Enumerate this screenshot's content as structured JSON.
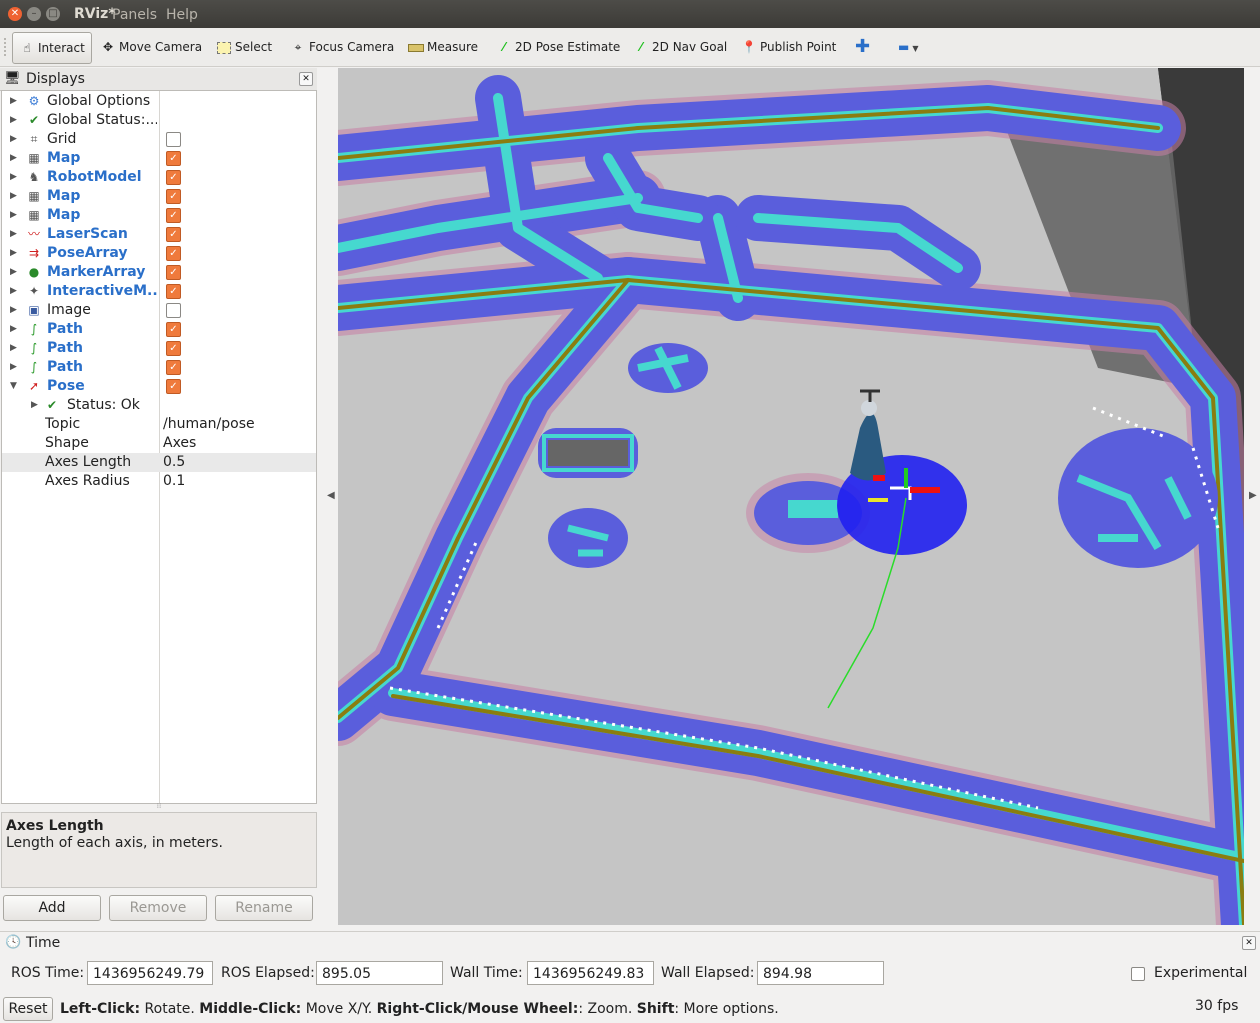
{
  "window": {
    "app_title": "RViz*",
    "menus": [
      "Panels",
      "Help"
    ]
  },
  "toolbar": {
    "tools": [
      {
        "label": "Interact",
        "icon": "hand-pointer-icon"
      },
      {
        "label": "Move Camera",
        "icon": "move-camera-icon"
      },
      {
        "label": "Select",
        "icon": "select-box-icon"
      },
      {
        "label": "Focus Camera",
        "icon": "focus-crosshair-icon"
      },
      {
        "label": "Measure",
        "icon": "ruler-icon"
      },
      {
        "label": "2D Pose Estimate",
        "icon": "pose-estimate-arrow-icon"
      },
      {
        "label": "2D Nav Goal",
        "icon": "nav-goal-arrow-icon"
      },
      {
        "label": "Publish Point",
        "icon": "map-pin-icon"
      }
    ],
    "active_tool": "Interact"
  },
  "displays": {
    "title": "Displays",
    "rows": [
      {
        "label": "Global Options",
        "blue": false,
        "check": null
      },
      {
        "label": "Global Status:...",
        "blue": false,
        "check": null
      },
      {
        "label": "Grid",
        "blue": false,
        "check": false
      },
      {
        "label": "Map",
        "blue": true,
        "check": true
      },
      {
        "label": "RobotModel",
        "blue": true,
        "check": true
      },
      {
        "label": "Map",
        "blue": true,
        "check": true
      },
      {
        "label": "Map",
        "blue": true,
        "check": true
      },
      {
        "label": "LaserScan",
        "blue": true,
        "check": true
      },
      {
        "label": "PoseArray",
        "blue": true,
        "check": true
      },
      {
        "label": "MarkerArray",
        "blue": true,
        "check": true
      },
      {
        "label": "InteractiveM...",
        "blue": true,
        "check": true
      },
      {
        "label": "Image",
        "blue": false,
        "check": false
      },
      {
        "label": "Path",
        "blue": true,
        "check": true
      },
      {
        "label": "Path",
        "blue": true,
        "check": true
      },
      {
        "label": "Path",
        "blue": true,
        "check": true
      },
      {
        "label": "Pose",
        "blue": true,
        "check": true
      }
    ],
    "pose_children": {
      "status": "Status: Ok",
      "props": [
        {
          "name": "Topic",
          "value": "/human/pose"
        },
        {
          "name": "Shape",
          "value": "Axes"
        },
        {
          "name": "Axes Length",
          "value": "0.5"
        },
        {
          "name": "Axes Radius",
          "value": "0.1"
        }
      ]
    },
    "description_title": "Axes Length",
    "description_text": "Length of each axis, in meters.",
    "buttons": {
      "add": "Add",
      "remove": "Remove",
      "rename": "Rename"
    }
  },
  "time": {
    "title": "Time",
    "ros_time_label": "ROS Time:",
    "ros_time": "1436956249.79",
    "ros_elapsed_label": "ROS Elapsed:",
    "ros_elapsed": "895.05",
    "wall_time_label": "Wall Time:",
    "wall_time": "1436956249.83",
    "wall_elapsed_label": "Wall Elapsed:",
    "wall_elapsed": "894.98",
    "experimental_label": "Experimental"
  },
  "status": {
    "reset_label": "Reset",
    "left_click_k": "Left-Click:",
    "left_click_v": " Rotate. ",
    "middle_click_k": "Middle-Click:",
    "middle_click_v": " Move X/Y. ",
    "right_click_k": "Right-Click/Mouse Wheel:",
    "right_click_v": ": Zoom. ",
    "shift_k": "Shift",
    "shift_v": ": More options.",
    "fps": "30 fps"
  },
  "colors": {
    "map_free": "#c4c4c4",
    "inflation": "#5b5fd9",
    "obstacle_cyan": "#47d8cf",
    "wall_olive": "#8a7d10",
    "checkbox_on": "#ef7a3c",
    "label_blue": "#2a6fc9"
  }
}
